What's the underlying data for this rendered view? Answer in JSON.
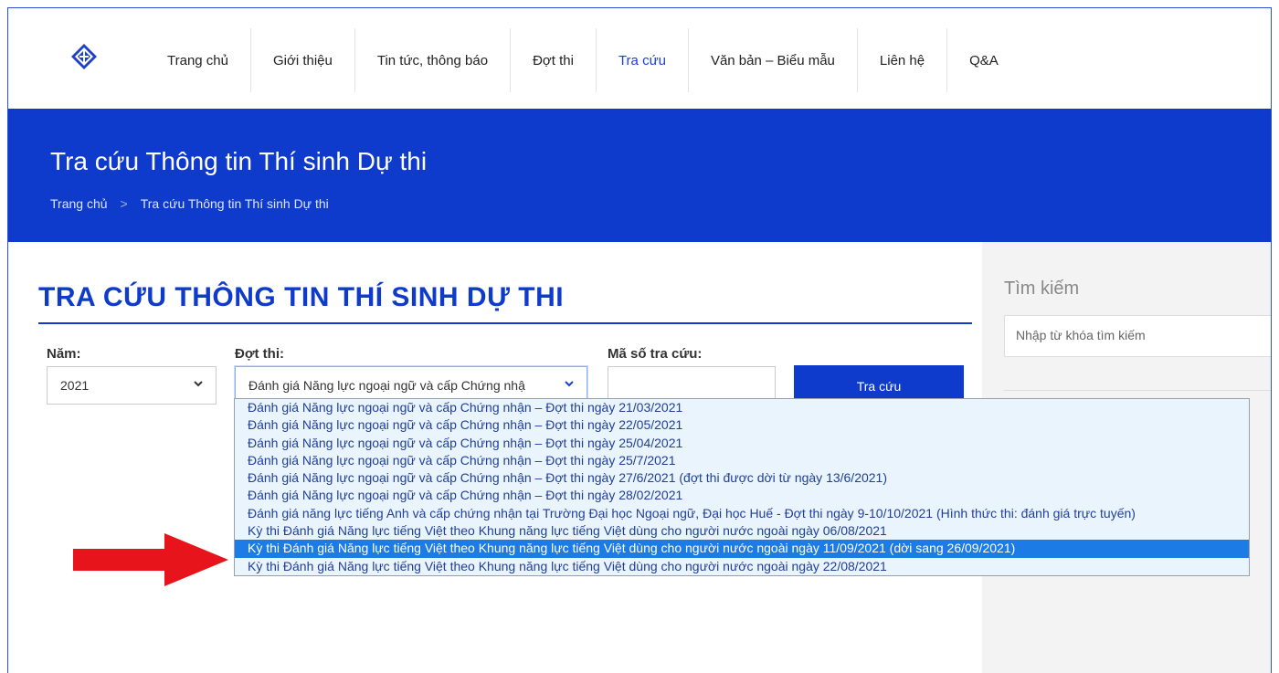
{
  "nav": {
    "items": [
      "Trang chủ",
      "Giới thiệu",
      "Tin tức, thông báo",
      "Đợt thi",
      "Tra cứu",
      "Văn bản – Biểu mẫu",
      "Liên hệ",
      "Q&A"
    ],
    "active_index": 4
  },
  "banner": {
    "title": "Tra cứu Thông tin Thí sinh Dự thi",
    "breadcrumb": [
      "Trang chủ",
      ">",
      "Tra cứu Thông tin Thí sinh Dự thi"
    ]
  },
  "main": {
    "heading": "TRA CỨU THÔNG TIN THÍ SINH DỰ THI",
    "form": {
      "year_label": "Năm:",
      "year_value": "2021",
      "session_label": "Đợt thi:",
      "session_value": "Đánh giá Năng lực ngoại ngữ và cấp Chứng nhậ",
      "code_label": "Mã số tra cứu:",
      "code_value": "",
      "submit_label": "Tra cứu"
    },
    "dropdown_options": [
      "Đánh giá Năng lực ngoại ngữ và cấp Chứng nhận – Đợt thi ngày 21/03/2021",
      "Đánh giá Năng lực ngoại ngữ và cấp Chứng nhận – Đợt thi ngày 22/05/2021",
      "Đánh giá Năng lực ngoại ngữ và cấp Chứng nhận – Đợt thi ngày 25/04/2021",
      "Đánh giá Năng lực ngoại ngữ và cấp Chứng nhận – Đợt thi ngày 25/7/2021",
      "Đánh giá Năng lực ngoại ngữ và cấp Chứng nhận – Đợt thi ngày 27/6/2021 (đợt thi được dời từ ngày 13/6/2021)",
      "Đánh giá Năng lực ngoại ngữ và cấp Chứng nhận – Đợt thi ngày 28/02/2021",
      "Đánh giá năng lực tiếng Anh và cấp chứng nhận tại Trường Đại học Ngoại ngữ, Đại học Huế - Đợt thi ngày 9-10/10/2021 (Hình thức thi: đánh giá trực tuyến)",
      "Kỳ thi Đánh giá Năng lực tiếng Việt theo Khung năng lực tiếng Việt dùng cho người nước ngoài ngày 06/08/2021",
      "Kỳ thi Đánh giá Năng lực tiếng Việt theo Khung năng lực tiếng Việt dùng cho người nước ngoài ngày 11/09/2021 (dời sang 26/09/2021)",
      "Kỳ thi Đánh giá Năng lực tiếng Việt theo Khung năng lực tiếng Việt dùng cho người nước ngoài ngày 22/08/2021"
    ],
    "selected_option_index": 8
  },
  "sidebar": {
    "search_title": "Tìm kiếm",
    "search_placeholder": "Nhập từ khóa tìm kiếm"
  },
  "colors": {
    "brand_blue": "#0e3bcb",
    "selected_option": "#1d7be6",
    "arrow_red": "#e8141b"
  },
  "icons": {
    "logo": "diamond-logo-icon",
    "chevron": "chevron-down-icon",
    "annotation": "red-arrow-icon"
  }
}
